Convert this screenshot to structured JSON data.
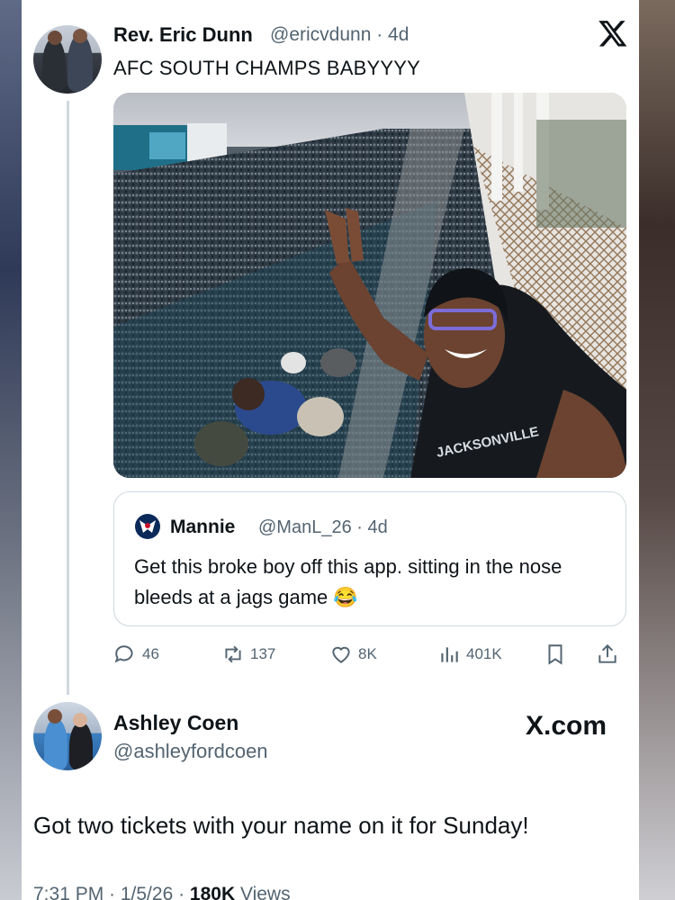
{
  "tweet1": {
    "name": "Rev. Eric Dunn",
    "handle_time": "@ericvdunn · 4d",
    "text": "AFC SOUTH CHAMPS BABYYYY",
    "quote": {
      "name": "Mannie",
      "handle_time": "@ManL_26 · 4d",
      "text": "Get this broke boy        off this app.      sitting in the nose bleeds at a jags game 😂"
    },
    "actions": {
      "replies": "46",
      "retweets": "137",
      "likes": "8K",
      "views": "401K"
    }
  },
  "tweet2": {
    "name": "Ashley Coen",
    "handle": "@ashleyfordcoen",
    "brand": "X.com",
    "text": "Got two tickets with your name on it for Sunday!",
    "meta_time": "7:31 PM · 1/5/26 · ",
    "meta_views_count": "180K",
    "meta_views_label": " Views"
  },
  "colors": {
    "text_primary": "#0f1419",
    "text_secondary": "#536471",
    "border": "#cfd9de",
    "texans_blue": "#0b2a5a",
    "texans_red": "#c8102e"
  },
  "icons": [
    "x-logo-icon",
    "reply-icon",
    "retweet-icon",
    "like-icon",
    "views-icon",
    "bookmark-icon",
    "share-icon",
    "texans-logo-icon"
  ]
}
